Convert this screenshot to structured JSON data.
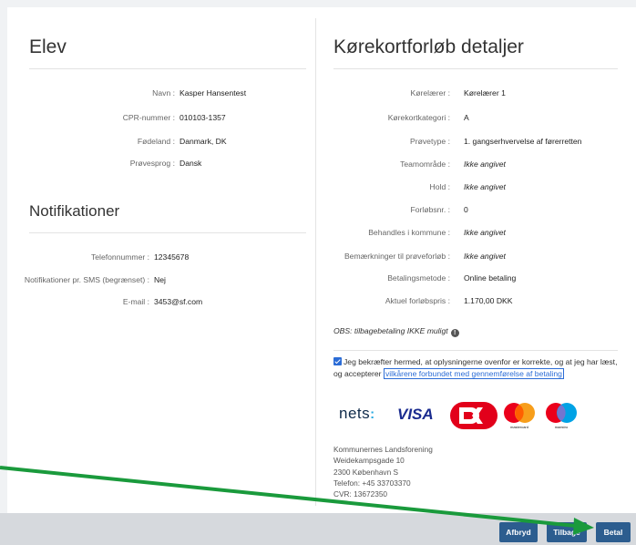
{
  "student": {
    "title": "Elev",
    "fields": [
      {
        "label": "Navn :",
        "value": "Kasper Hansentest"
      },
      {
        "label": "CPR-nummer :",
        "value": "010103-1357"
      },
      {
        "label": "Fødeland :",
        "value": "Danmark, DK"
      },
      {
        "label": "Prøvesprog :",
        "value": "Dansk"
      }
    ]
  },
  "notifications": {
    "title": "Notifikationer",
    "fields": [
      {
        "label": "Telefonnummer :",
        "value": "12345678"
      },
      {
        "label": "Notifikationer pr. SMS (begrænset) :",
        "value": "Nej"
      },
      {
        "label": "E-mail :",
        "value": "3453@sf.com"
      }
    ]
  },
  "course": {
    "title": "Kørekortforløb detaljer",
    "fields": [
      {
        "label": "Kørelærer :",
        "value": "Kørelærer 1"
      },
      {
        "label": "Kørekortkategori :",
        "value": "A"
      },
      {
        "label": "Prøvetype :",
        "value": "1. gangserhvervelse af førerretten"
      },
      {
        "label": "Teamområde :",
        "value": "Ikke angivet"
      },
      {
        "label": "Hold :",
        "value": "Ikke angivet"
      },
      {
        "label": "Forløbsnr. :",
        "value": "0"
      },
      {
        "label": "Behandles i kommune :",
        "value": "Ikke angivet"
      },
      {
        "label": "Bemærkninger til prøveforløb :",
        "value": "Ikke angivet"
      },
      {
        "label": "Betalingsmetode :",
        "value": "Online betaling"
      },
      {
        "label": "Aktuel forløbspris :",
        "value": "1.170,00 DKK"
      }
    ],
    "obs_text": "OBS: tilbagebetaling IKKE muligt",
    "confirm_text": "Jeg bekræfter hermed, at oplysningerne ovenfor er korrekte, og at jeg har læst, og accepterer",
    "terms_link": "vilkårene forbundet med gennemførelse af betaling",
    "confirm_checked": true
  },
  "payment_logos": {
    "nets": "nets",
    "visa": "VISA",
    "mastercard": "mastercard",
    "maestro": "maestro"
  },
  "address": {
    "lines": [
      "Kommunernes Landsforening",
      "Weidekampsgade 10",
      "2300 København S",
      "Telefon: +45 33703370",
      "CVR: 13672350"
    ]
  },
  "footer": {
    "cancel_label": "Afbryd",
    "back_label": "Tilbage",
    "pay_label": "Betal"
  },
  "colors": {
    "primary_button": "#2c5d8f",
    "link": "#2b6cd6",
    "arrow": "#1a9a3c"
  }
}
